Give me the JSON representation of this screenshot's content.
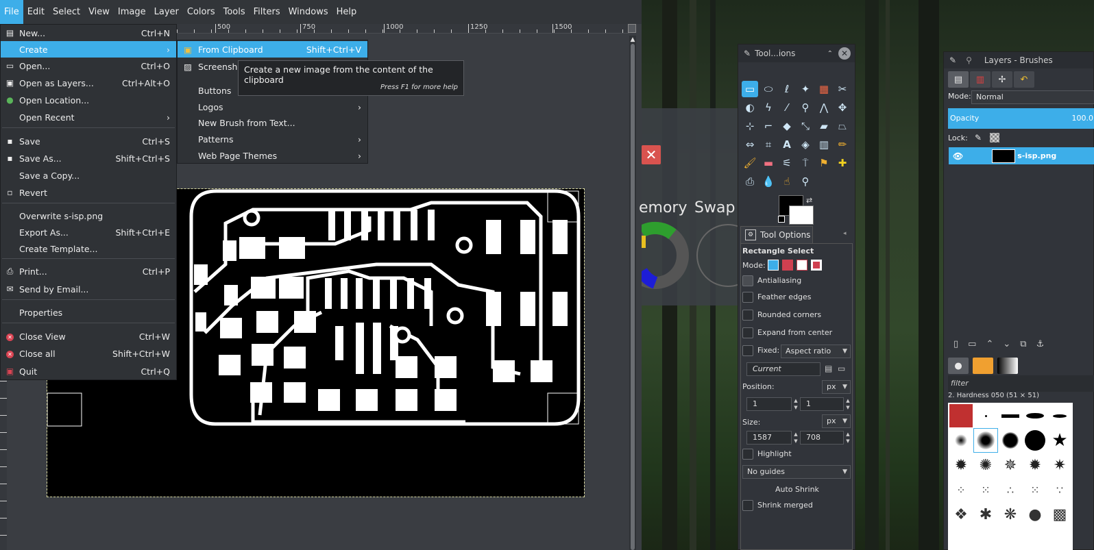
{
  "menubar": {
    "items": [
      "File",
      "Edit",
      "Select",
      "View",
      "Image",
      "Layer",
      "Colors",
      "Tools",
      "Filters",
      "Windows",
      "Help"
    ]
  },
  "ruler": {
    "labels": [
      "500",
      "750",
      "1000",
      "1250",
      "1500"
    ]
  },
  "file_menu": {
    "items": [
      {
        "label": "New...",
        "shortcut": "Ctrl+N",
        "icon": "new-document-icon"
      },
      {
        "label": "Create",
        "shortcut": "",
        "icon": "",
        "submenu": true
      },
      {
        "label": "Open...",
        "shortcut": "Ctrl+O",
        "icon": "folder-open-icon"
      },
      {
        "label": "Open as Layers...",
        "shortcut": "Ctrl+Alt+O",
        "icon": "open-layers-icon"
      },
      {
        "label": "Open Location...",
        "shortcut": "",
        "icon": "globe-icon"
      },
      {
        "label": "Open Recent",
        "shortcut": "",
        "icon": "",
        "submenu": true
      },
      {
        "label": "Save",
        "shortcut": "Ctrl+S",
        "icon": "save-icon"
      },
      {
        "label": "Save As...",
        "shortcut": "Shift+Ctrl+S",
        "icon": "save-as-icon"
      },
      {
        "label": "Save a Copy...",
        "shortcut": "",
        "icon": ""
      },
      {
        "label": "Revert",
        "shortcut": "",
        "icon": "revert-icon"
      },
      {
        "label": "Overwrite s-isp.png",
        "shortcut": "",
        "icon": ""
      },
      {
        "label": "Export As...",
        "shortcut": "Shift+Ctrl+E",
        "icon": ""
      },
      {
        "label": "Create Template...",
        "shortcut": "",
        "icon": ""
      },
      {
        "label": "Print...",
        "shortcut": "Ctrl+P",
        "icon": "print-icon"
      },
      {
        "label": "Send by Email...",
        "shortcut": "",
        "icon": "email-icon"
      },
      {
        "label": "Properties",
        "shortcut": "",
        "icon": ""
      },
      {
        "label": "Close View",
        "shortcut": "Ctrl+W",
        "icon": "close-red-icon"
      },
      {
        "label": "Close all",
        "shortcut": "Shift+Ctrl+W",
        "icon": "close-red-icon"
      },
      {
        "label": "Quit",
        "shortcut": "Ctrl+Q",
        "icon": "quit-icon"
      }
    ]
  },
  "create_submenu": {
    "items": [
      {
        "label": "From Clipboard",
        "shortcut": "Shift+Ctrl+V"
      },
      {
        "label": "Screenshot..."
      },
      {
        "label": "Buttons"
      },
      {
        "label": "Logos"
      },
      {
        "label": "New Brush from Text..."
      },
      {
        "label": "Patterns"
      },
      {
        "label": "Web Page Themes"
      }
    ]
  },
  "tooltip": {
    "text": "Create a new image from the content of the clipboard",
    "help": "Press F1 for more help"
  },
  "desktop_widget": {
    "memory_label": "emory",
    "swap_label": "Swap"
  },
  "toolbox": {
    "title": "Tool...ions"
  },
  "tool_options": {
    "tab_label": "Tool Options",
    "tool_name": "Rectangle Select",
    "mode_label": "Mode:",
    "antialiasing": "Antialiasing",
    "feather": "Feather edges",
    "rounded": "Rounded corners",
    "expand": "Expand from center",
    "fixed": "Fixed:",
    "fixed_value": "Aspect ratio",
    "current": "Current",
    "position_label": "Position:",
    "position_unit": "px",
    "pos_x": "1",
    "pos_y": "1",
    "size_label": "Size:",
    "size_unit": "px",
    "size_w": "1587",
    "size_h": "708",
    "highlight": "Highlight",
    "guides": "No guides",
    "auto_shrink": "Auto Shrink",
    "shrink_merged": "Shrink merged"
  },
  "layers": {
    "title": "Layers - Brushes",
    "mode_label": "Mode:",
    "mode_value": "Normal",
    "opacity_label": "Opacity",
    "opacity_value": "100.0",
    "lock_label": "Lock:",
    "layer_name": "s-isp.png",
    "filter_placeholder": "filter",
    "brush_name": "2. Hardness 050 (51 × 51)"
  }
}
